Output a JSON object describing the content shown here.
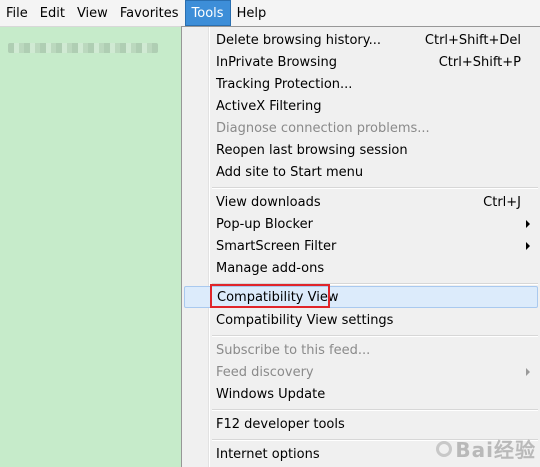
{
  "menubar": {
    "items": [
      {
        "label": "File"
      },
      {
        "label": "Edit"
      },
      {
        "label": "View"
      },
      {
        "label": "Favorites"
      },
      {
        "label": "Tools",
        "active": true
      },
      {
        "label": "Help"
      }
    ]
  },
  "tools_menu": {
    "groups": [
      [
        {
          "label": "Delete browsing history...",
          "shortcut": "Ctrl+Shift+Del"
        },
        {
          "label": "InPrivate Browsing",
          "shortcut": "Ctrl+Shift+P"
        },
        {
          "label": "Tracking Protection..."
        },
        {
          "label": "ActiveX Filtering"
        },
        {
          "label": "Diagnose connection problems...",
          "disabled": true
        },
        {
          "label": "Reopen last browsing session"
        },
        {
          "label": "Add site to Start menu"
        }
      ],
      [
        {
          "label": "View downloads",
          "shortcut": "Ctrl+J"
        },
        {
          "label": "Pop-up Blocker",
          "submenu": true
        },
        {
          "label": "SmartScreen Filter",
          "submenu": true
        },
        {
          "label": "Manage add-ons"
        }
      ],
      [
        {
          "label": "Compatibility View",
          "highlighted": true
        },
        {
          "label": "Compatibility View settings"
        }
      ],
      [
        {
          "label": "Subscribe to this feed...",
          "disabled": true
        },
        {
          "label": "Feed discovery",
          "disabled": true,
          "submenu": true
        },
        {
          "label": "Windows Update"
        }
      ],
      [
        {
          "label": "F12 developer tools"
        }
      ],
      [
        {
          "label": "Internet options"
        }
      ]
    ]
  },
  "watermark": {
    "text": "Bai经验"
  },
  "colors": {
    "content_bg": "#c6ebca",
    "active_menu": "#3d8ed8",
    "highlight_box": "#e0252a"
  }
}
